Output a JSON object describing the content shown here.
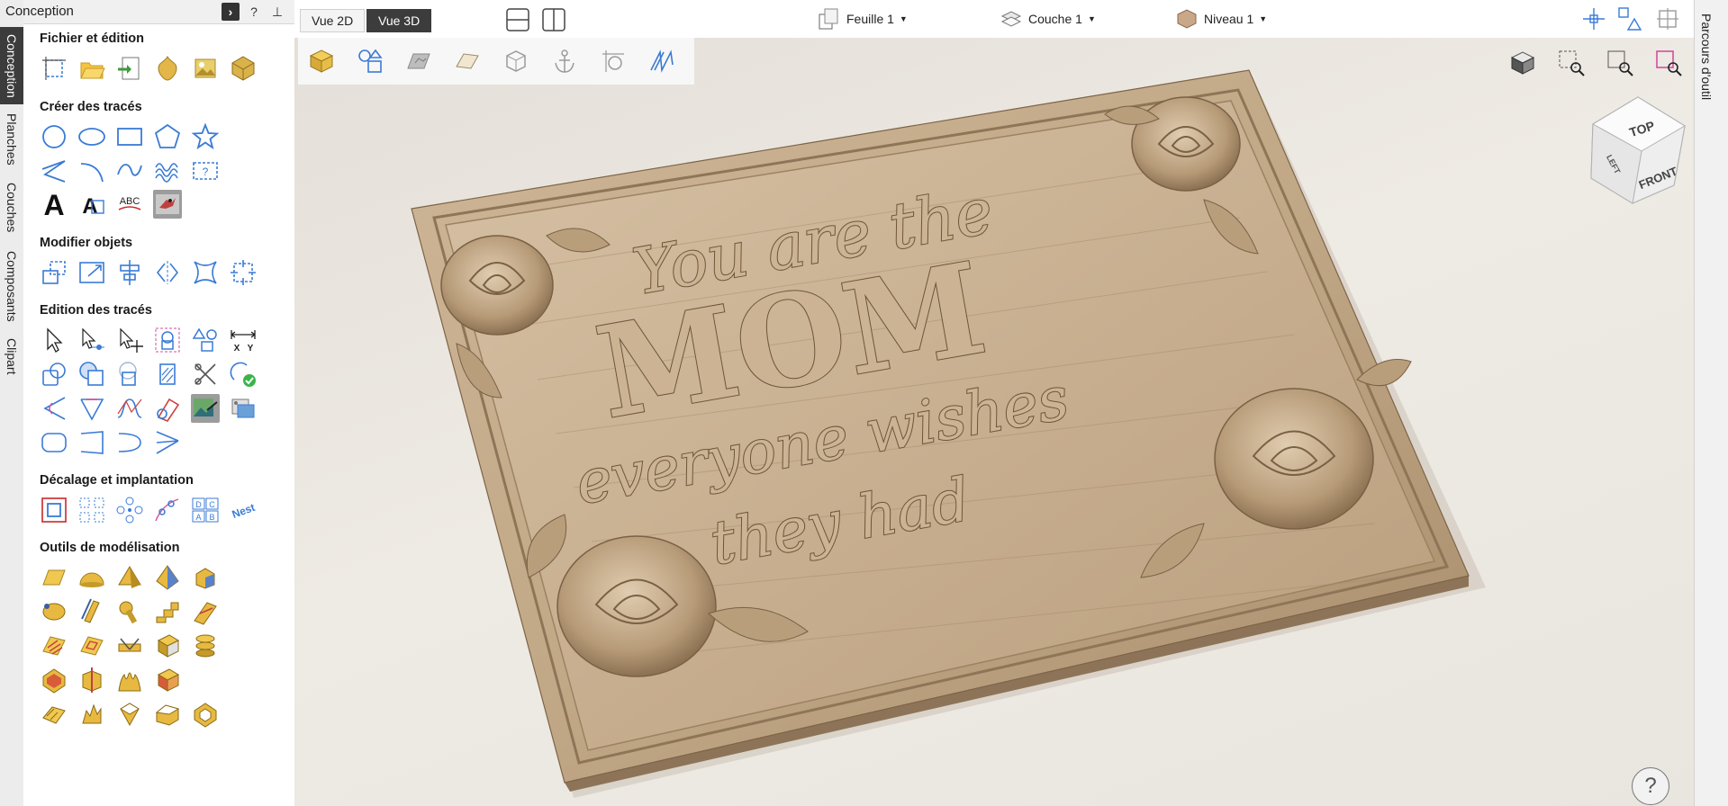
{
  "panel": {
    "title": "Conception",
    "vertical_tabs": [
      "Conception",
      "Planches",
      "Couches",
      "Composants",
      "Clipart"
    ],
    "sections": [
      {
        "title": "Fichier et édition"
      },
      {
        "title": "Créer des tracés"
      },
      {
        "title": "Modifier objets"
      },
      {
        "title": "Edition des tracés"
      },
      {
        "title": "Décalage et implantation"
      },
      {
        "title": "Outils de modélisation"
      }
    ],
    "icon_text": {
      "abc": "ABC",
      "big_a": "A",
      "dcab": [
        "D",
        "C",
        "A",
        "B"
      ],
      "nest": "Nest"
    }
  },
  "header_buttons": {
    "collapse": "›",
    "help": "?",
    "pin": "⊥"
  },
  "topbar": {
    "view_2d": "Vue 2D",
    "view_3d": "Vue 3D",
    "sheet": "Feuille 1",
    "layer": "Couche 1",
    "level": "Niveau 1"
  },
  "right_rail": {
    "label": "Parcours d'outil"
  },
  "viewcube": {
    "top": "TOP",
    "front": "FRONT",
    "left": "LEFT"
  },
  "model": {
    "lines": [
      "You are the",
      "MOM",
      "everyone wishes",
      "they had"
    ]
  },
  "help": "?",
  "colors": {
    "accent": "#3a7bd5",
    "model": "#c4ab8c",
    "dark_tab": "#3c3c3c",
    "gold": "#d9b24a"
  }
}
